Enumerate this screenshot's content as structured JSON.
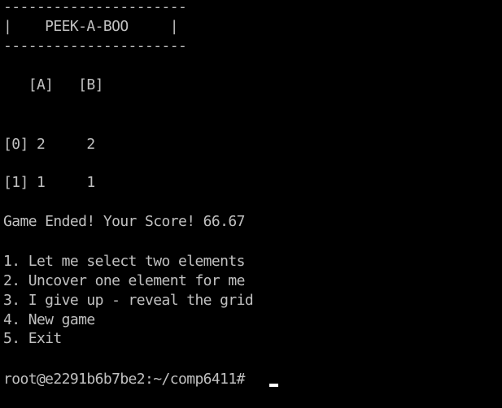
{
  "terminal": {
    "banner_top": "----------------------",
    "banner_title": "|    PEEK-A-BOO     |",
    "banner_bottom": "----------------------",
    "column_header": "   [A]   [B]",
    "grid_rows": [
      "[0] 2     2",
      "[1] 1     1"
    ],
    "status": "Game Ended! Your Score! 66.67",
    "menu_items": [
      "1. Let me select two elements",
      "2. Uncover one element for me",
      "3. I give up - reveal the grid",
      "4. New game",
      "5. Exit"
    ],
    "prompt": "root@e2291b6b7be2:~/comp6411# "
  },
  "colors": {
    "background": "#000000",
    "text": "#c0c0c0",
    "cursor": "#ffffff"
  }
}
